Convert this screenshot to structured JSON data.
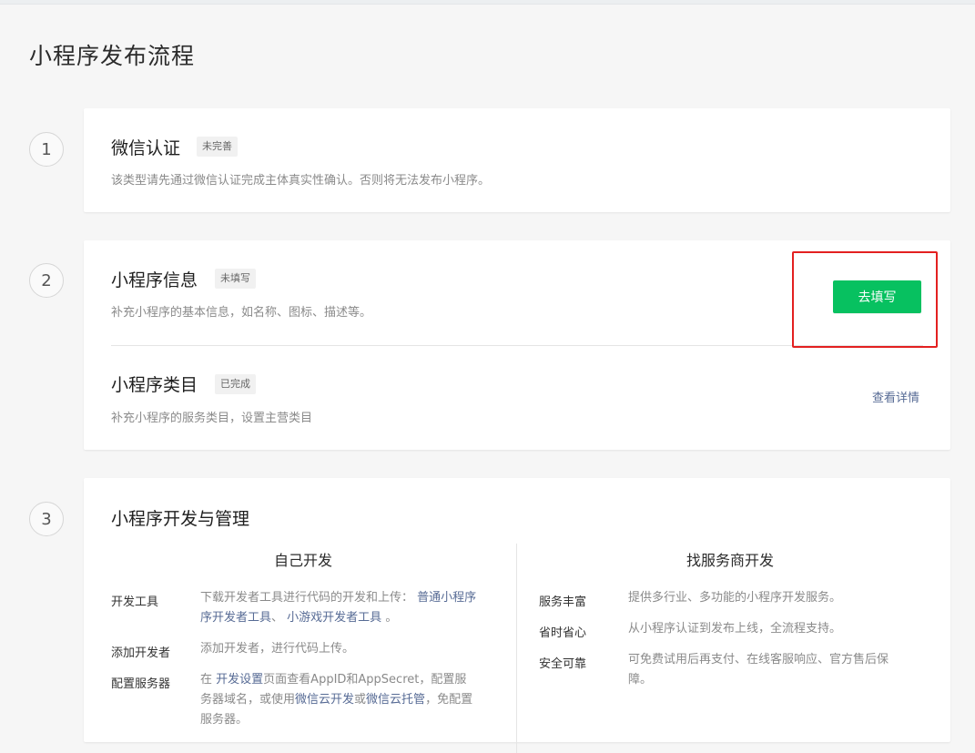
{
  "page_title": "小程序发布流程",
  "steps": {
    "s1": "1",
    "s2": "2",
    "s3": "3"
  },
  "wechat_auth": {
    "title": "微信认证",
    "badge": "未完善",
    "desc": "该类型请先通过微信认证完成主体真实性确认。否则将无法发布小程序。"
  },
  "mini_info": {
    "title": "小程序信息",
    "badge": "未填写",
    "desc": "补充小程序的基本信息，如名称、图标、描述等。",
    "button": "去填写"
  },
  "mini_category": {
    "title": "小程序类目",
    "badge": "已完成",
    "desc": "补充小程序的服务类目，设置主营类目",
    "link": "查看详情"
  },
  "dev_manage": {
    "title": "小程序开发与管理",
    "self_dev": {
      "heading": "自己开发",
      "rows": [
        {
          "label": "开发工具",
          "text_pre": "下载开发者工具进行代码的开发和上传：",
          "link1_part1": "普通小程序",
          "link1_part2": "序开发者工具",
          "sep": "、",
          "link2": "小游戏开发者工具",
          "text_post": "。"
        },
        {
          "label": "添加开发者",
          "text": "添加开发者，进行代码上传。"
        },
        {
          "label": "配置服务器",
          "p1": "在",
          "link1": "开发设置",
          "p2": "页面查看AppID和AppSecret，配置服",
          "p3": "务器域名，或使用",
          "link2": "微信云开发",
          "p4": "或",
          "link3": "微信云托管",
          "p5": "，免配置",
          "p6": "服务器。"
        }
      ]
    },
    "vendor_dev": {
      "heading": "找服务商开发",
      "rows": [
        {
          "label": "服务丰富",
          "text": "提供多行业、多功能的小程序开发服务。"
        },
        {
          "label": "省时省心",
          "text": "从小程序认证到发布上线，全流程支持。"
        },
        {
          "label": "安全可靠",
          "line1": "可免费试用后再支付、在线客服响应、官方售后保",
          "line2": "障。"
        }
      ]
    }
  },
  "colors": {
    "primary_green": "#07c160",
    "link_blue": "#576b95",
    "highlight_red": "#e32020"
  }
}
